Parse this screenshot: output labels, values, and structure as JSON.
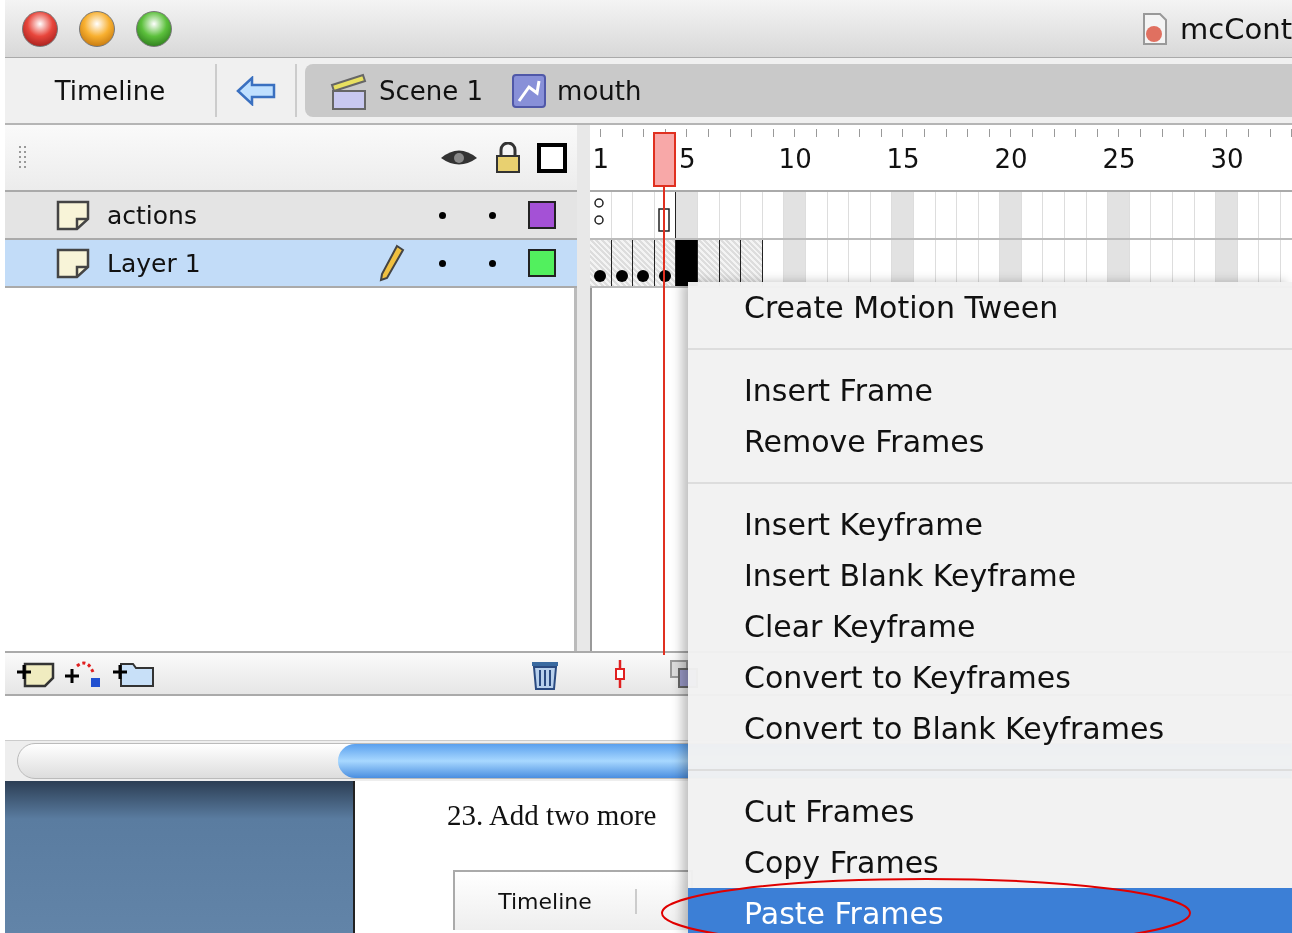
{
  "window": {
    "title": "mcCont"
  },
  "toolbar": {
    "panel_title": "Timeline",
    "breadcrumbs": [
      {
        "label": "Scene 1",
        "kind": "scene"
      },
      {
        "label": "mouth",
        "kind": "symbol"
      }
    ]
  },
  "ruler": {
    "frame_numbers": [
      "1",
      "5",
      "10",
      "15",
      "20",
      "25",
      "30"
    ]
  },
  "layers": [
    {
      "name": "actions",
      "selected": false,
      "editing": false,
      "color": "#a451d6"
    },
    {
      "name": "Layer 1",
      "selected": true,
      "editing": true,
      "color": "#52f05e"
    }
  ],
  "context_menu": {
    "groups": [
      [
        {
          "label": "Create Motion Tween",
          "selected": false
        }
      ],
      [
        {
          "label": "Insert Frame",
          "selected": false
        },
        {
          "label": "Remove Frames",
          "selected": false
        }
      ],
      [
        {
          "label": "Insert Keyframe",
          "selected": false
        },
        {
          "label": "Insert Blank Keyframe",
          "selected": false
        },
        {
          "label": "Clear Keyframe",
          "selected": false
        },
        {
          "label": "Convert to Keyframes",
          "selected": false
        },
        {
          "label": "Convert to Blank Keyframes",
          "selected": false
        }
      ],
      [
        {
          "label": "Cut Frames",
          "selected": false
        },
        {
          "label": "Copy Frames",
          "selected": false
        },
        {
          "label": "Paste Frames",
          "selected": true
        }
      ]
    ]
  },
  "document": {
    "step_text": "23. Add two more",
    "tab_label": "Timeline"
  }
}
